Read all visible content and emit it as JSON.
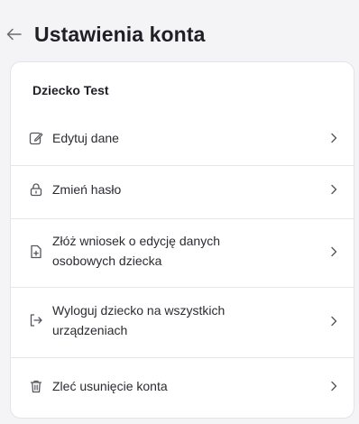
{
  "header": {
    "title": "Ustawienia konta",
    "back_icon": "arrow-left-icon"
  },
  "card": {
    "user_name": "Dziecko Test",
    "items": [
      {
        "label": "Edytuj dane",
        "icon": "edit-icon"
      },
      {
        "label": "Zmień hasło",
        "icon": "lock-icon"
      },
      {
        "label": "Złóż wniosek o edycję danych osobowych dziecka",
        "icon": "document-add-icon"
      },
      {
        "label": "Wyloguj dziecko na wszystkich urządzeniach",
        "icon": "logout-icon"
      },
      {
        "label": "Zleć usunięcie konta",
        "icon": "trash-icon"
      }
    ]
  },
  "colors": {
    "background": "#f4f4f6",
    "card": "#ffffff",
    "text": "#1f1f25",
    "icon": "#55555c",
    "divider": "#e6e6ea"
  }
}
